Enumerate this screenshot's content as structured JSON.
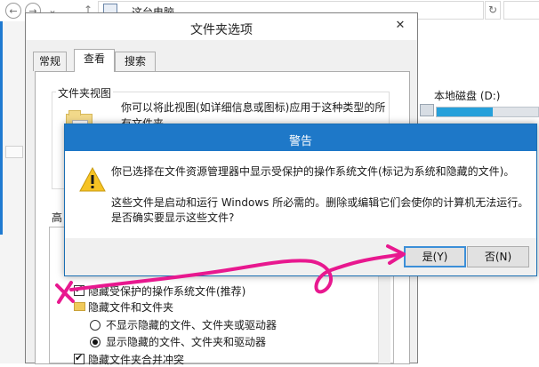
{
  "explorer": {
    "address": "这台电脑",
    "drive": {
      "label": "本地磁盘 (D:)",
      "used_fraction": 0.55
    },
    "nav": {
      "back_glyph": "←",
      "forward_glyph": "→",
      "up_glyph": "↑",
      "refresh_glyph": "↻",
      "menu_glyph": "⌄"
    }
  },
  "folder_dialog": {
    "title": "文件夹选项",
    "close_glyph": "✕",
    "tabs": [
      "常规",
      "查看",
      "搜索"
    ],
    "active_tab": "查看",
    "view_group_label": "文件夹视图",
    "view_description": "你可以将此视图(如详细信息或图标)应用于这种类型的所有文件夹。",
    "advanced_label": "高",
    "settings": [
      {
        "label": "隐藏受保护的操作系统文件(推荐)",
        "kind": "checkbox",
        "checked": true
      },
      {
        "label": "隐藏文件和文件夹",
        "kind": "folder"
      },
      {
        "label": "不显示隐藏的文件、文件夹或驱动器",
        "kind": "radio",
        "checked": false
      },
      {
        "label": "显示隐藏的文件、文件夹和驱动器",
        "kind": "radio",
        "checked": true
      },
      {
        "label": "隐藏文件夹合并冲突",
        "kind": "checkbox",
        "checked": true
      }
    ]
  },
  "warning_dialog": {
    "title": "警告",
    "message_line1": "你已选择在文件资源管理器中显示受保护的操作系统文件(标记为系统和隐藏的文件)。",
    "message_line2": "这些文件是启动和运行 Windows 所必需的。删除或编辑它们会使你的计算机无法运行。",
    "message_line3": "是否确实要显示这些文件?",
    "yes_label": "是(Y)",
    "no_label": "否(N)",
    "icon": "warning-icon"
  },
  "colors": {
    "title_blue": "#1e78c8",
    "annotation_pink": "#e8188f"
  }
}
